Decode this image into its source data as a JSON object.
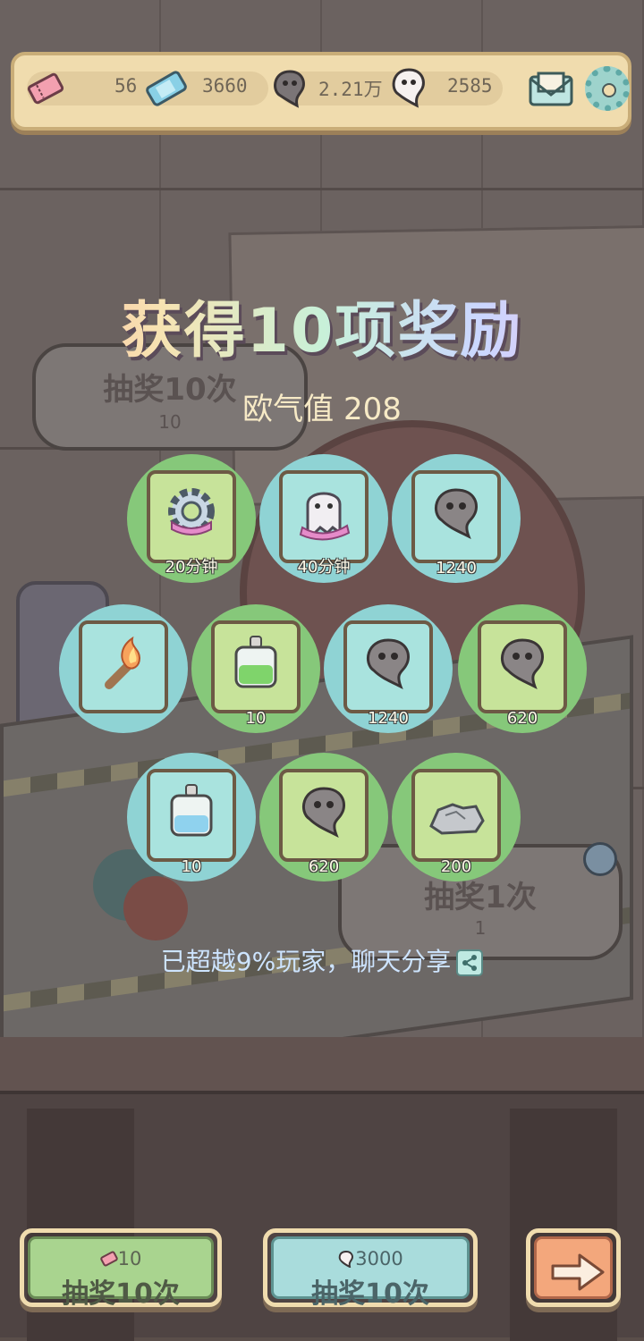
{
  "currency_bar": {
    "ticket": "56",
    "gem": "3660",
    "dark_soul": "2.21万",
    "light_soul": "2585"
  },
  "background_panels": {
    "left": {
      "label": "抽奖10次",
      "cost": "10"
    },
    "right": {
      "label": "抽奖1次",
      "cost": "1"
    }
  },
  "result": {
    "title": "获得10项奖励",
    "luck_label": "欧气值 208"
  },
  "rewards": [
    {
      "icon": "gear-speedup-icon",
      "amount": "20分钟",
      "bg": "green"
    },
    {
      "icon": "ghost-speedup-icon",
      "amount": "40分钟",
      "bg": "teal"
    },
    {
      "icon": "dark-soul-icon",
      "amount": "1240",
      "bg": "teal"
    },
    {
      "icon": "flame-torch-icon",
      "amount": "",
      "bg": "teal"
    },
    {
      "icon": "green-potion-icon",
      "amount": "10",
      "bg": "green"
    },
    {
      "icon": "dark-soul-icon",
      "amount": "1240",
      "bg": "teal"
    },
    {
      "icon": "dark-soul-icon",
      "amount": "620",
      "bg": "green"
    },
    {
      "icon": "blue-potion-icon",
      "amount": "10",
      "bg": "teal"
    },
    {
      "icon": "dark-soul-icon",
      "amount": "620",
      "bg": "green"
    },
    {
      "icon": "stone-icon",
      "amount": "200",
      "bg": "green"
    }
  ],
  "share_text": "已超越9%玩家，聊天分享",
  "buttons": {
    "draw_ticket": {
      "cost": "10",
      "label": "抽奖10次"
    },
    "draw_soul": {
      "cost": "3000",
      "label": "抽奖10次"
    }
  },
  "colors": {
    "reward_green": "#86c87a",
    "reward_teal": "#8fd3d4",
    "topbar": "#f0dcae"
  }
}
